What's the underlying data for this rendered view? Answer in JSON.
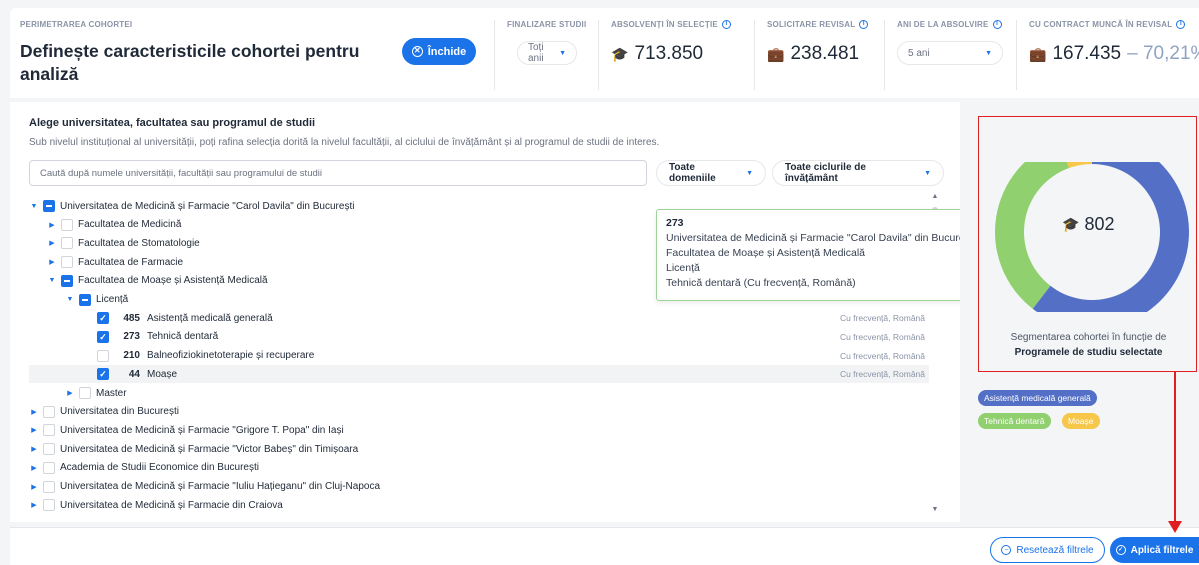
{
  "header": {
    "cohort_label": "PERIMETRAREA COHORTEI",
    "title": "Definește caracteristicile cohortei pentru analiză",
    "close_label": "Închide",
    "kpis": {
      "graduation": {
        "label": "FINALIZARE STUDII",
        "select": "Toți anii"
      },
      "graduates": {
        "label": "ABSOLVENȚI ÎN SELECȚIE",
        "value": "713.850",
        "icon": "graduation-cap-icon"
      },
      "revisal": {
        "label": "SOLICITARE REVISAL",
        "value": "238.481",
        "icon": "briefcase-icon"
      },
      "years": {
        "label": "ANI DE LA ABSOLVIRE",
        "select": "5 ani"
      },
      "contract": {
        "label": "CU CONTRACT MUNCĂ ÎN REVISAL",
        "value": "167.435",
        "pct": "– 70,21%",
        "icon": "briefcase-icon"
      }
    }
  },
  "panel": {
    "title": "Alege universitatea, facultatea sau programul de studii",
    "subtitle": "Sub nivelul instituțional al universității, poți rafina selecția dorită la nivelul facultății, al ciclului de învățământ și al programul de studii de interes.",
    "search_placeholder": "Caută după numele universității, facultății sau programului de studii",
    "filter_domains": "Toate domeniile",
    "filter_cycles": "Toate ciclurile de învățământ"
  },
  "tree": [
    {
      "label": "Universitatea de Medicină și Farmacie \"Carol Davila\" din București",
      "level": 0,
      "state": "partial",
      "expanded": true
    },
    {
      "label": "Facultatea de Medicină",
      "level": 1,
      "state": "none",
      "expanded": false
    },
    {
      "label": "Facultatea de Stomatologie",
      "level": 1,
      "state": "none",
      "expanded": false
    },
    {
      "label": "Facultatea de Farmacie",
      "level": 1,
      "state": "none",
      "expanded": false
    },
    {
      "label": "Facultatea de Moașe și Asistență Medicală",
      "level": 1,
      "state": "partial",
      "expanded": true
    },
    {
      "label": "Licență",
      "level": 2,
      "state": "partial",
      "expanded": true
    },
    {
      "num": "485",
      "label": "Asistență medicală generală",
      "level": 3,
      "state": "checked",
      "meta": "Cu frecvență, Română"
    },
    {
      "num": "273",
      "label": "Tehnică dentară",
      "level": 3,
      "state": "checked",
      "meta": "Cu frecvență, Română"
    },
    {
      "num": "210",
      "label": "Balneofiziokinetoterapie și recuperare",
      "level": 3,
      "state": "none",
      "meta": "Cu frecvență, Română"
    },
    {
      "num": "44",
      "label": "Moașe",
      "level": 3,
      "state": "checked",
      "meta": "Cu frecvență, Română",
      "highlight": true
    },
    {
      "label": "Master",
      "level": 2,
      "state": "none",
      "expanded": false
    },
    {
      "label": "Universitatea din București",
      "level": 0,
      "state": "none",
      "expanded": false
    },
    {
      "label": "Universitatea de Medicină și Farmacie \"Grigore T. Popa\" din Iași",
      "level": 0,
      "state": "none",
      "expanded": false
    },
    {
      "label": "Universitatea de Medicină și Farmacie \"Victor Babeș\" din Timișoara",
      "level": 0,
      "state": "none",
      "expanded": false
    },
    {
      "label": "Academia de Studii Economice din București",
      "level": 0,
      "state": "none",
      "expanded": false
    },
    {
      "label": "Universitatea de Medicină și Farmacie \"Iuliu Hațieganu\" din Cluj-Napoca",
      "level": 0,
      "state": "none",
      "expanded": false
    },
    {
      "label": "Universitatea de Medicină și Farmacie din Craiova",
      "level": 0,
      "state": "none",
      "expanded": false
    }
  ],
  "tooltip": {
    "lines": [
      "273",
      "Universitatea de Medicină și Farmacie \"Carol Davila\" din București",
      "Facultatea de Moașe și Asistență Medicală",
      "Licență",
      "Tehnică dentară (Cu frecvență, Română)"
    ]
  },
  "segment": {
    "total": "802",
    "caption_line1": "Segmentarea cohortei în funcție de",
    "caption_line2": "Programele de studiu selectate"
  },
  "chart_data": {
    "type": "pie",
    "donut": true,
    "categories": [
      "Asistență medicală generală",
      "Tehnică dentară",
      "Moașe"
    ],
    "values": [
      485,
      273,
      44
    ],
    "colors": [
      "#5470c6",
      "#91d06e",
      "#f7c74a"
    ]
  },
  "footer": {
    "reset_label": "Resetează filtrele",
    "apply_label": "Aplică filtrele"
  },
  "colors": {
    "accent": "#1a73e8",
    "annotation": "#e02020"
  }
}
